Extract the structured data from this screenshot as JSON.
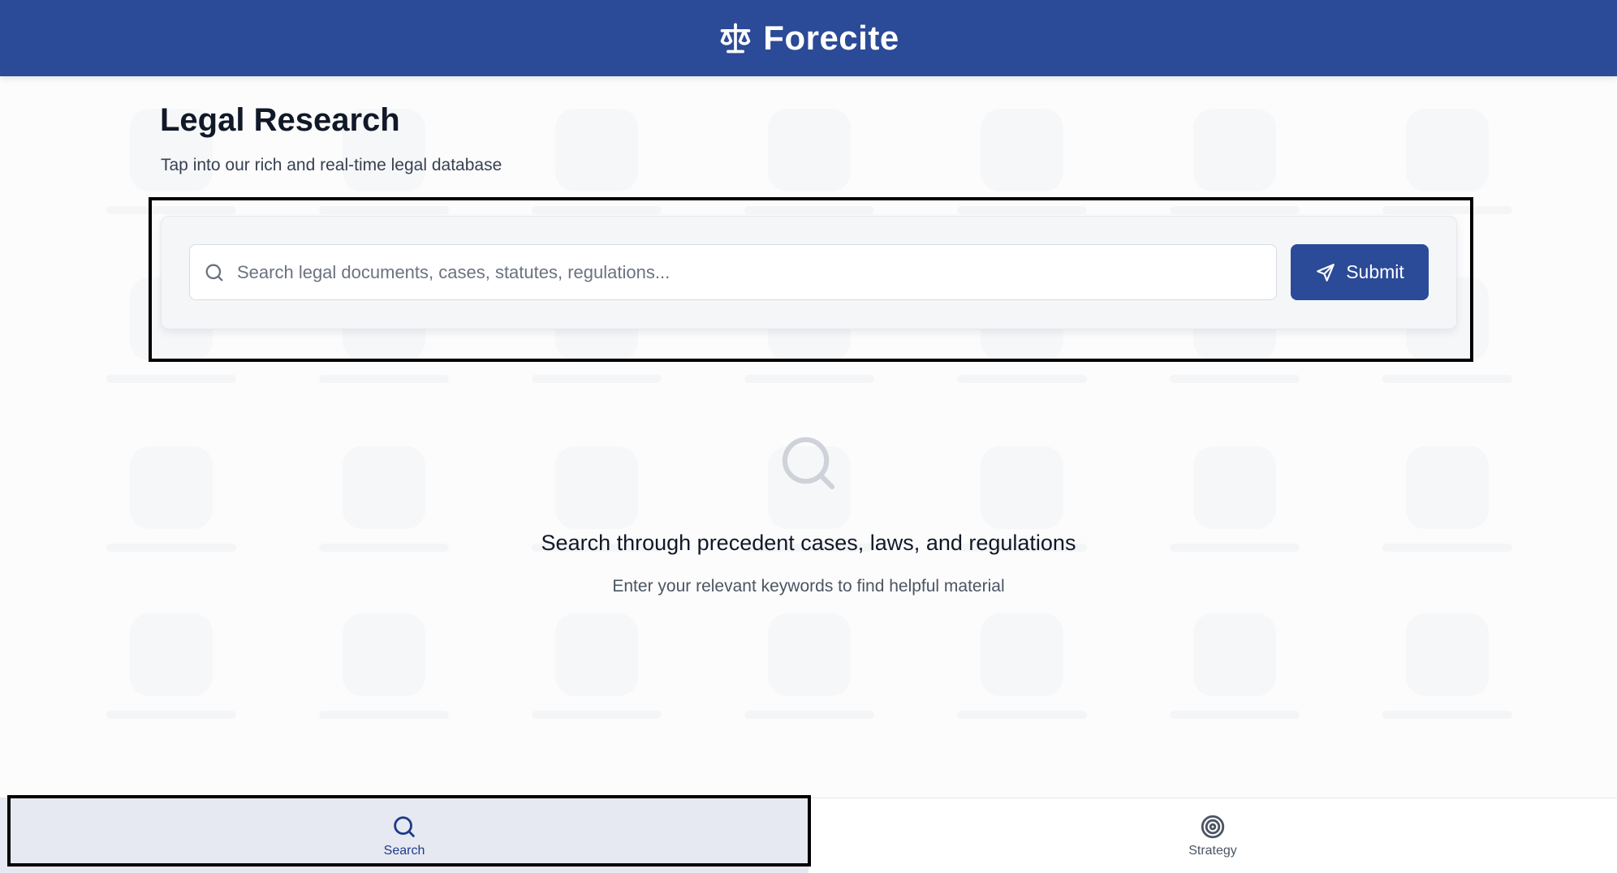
{
  "app": {
    "name": "Forecite",
    "logo_icon": "scales-icon",
    "brand_color": "#2b4a97"
  },
  "page": {
    "title": "Legal Research",
    "subtitle": "Tap into our rich and real-time legal database"
  },
  "search": {
    "placeholder": "Search legal documents, cases, statutes, regulations...",
    "value": "",
    "icon": "search-icon",
    "submit_label": "Submit",
    "submit_icon": "send-icon"
  },
  "empty_state": {
    "icon": "search-icon",
    "title": "Search through precedent cases, laws, and regulations",
    "text": "Enter your relevant keywords to find helpful material"
  },
  "bottom_nav": {
    "items": [
      {
        "label": "Search",
        "icon": "search-icon",
        "active": true
      },
      {
        "label": "Strategy",
        "icon": "target-icon",
        "active": false
      }
    ]
  }
}
